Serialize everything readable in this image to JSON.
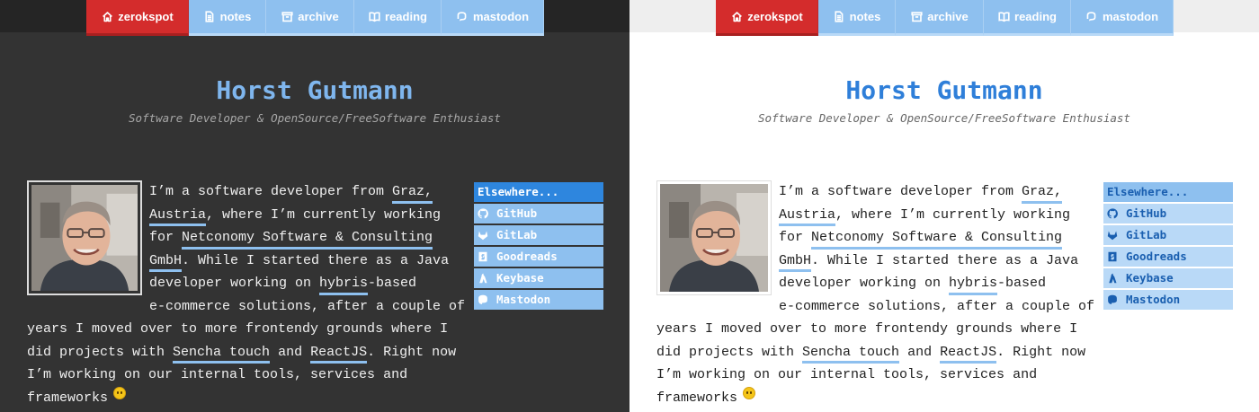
{
  "nav": {
    "items": [
      {
        "label": "zerokspot",
        "icon": "home-icon",
        "active": true
      },
      {
        "label": "notes",
        "icon": "document-icon"
      },
      {
        "label": "archive",
        "icon": "archive-box-icon"
      },
      {
        "label": "reading",
        "icon": "open-book-icon"
      },
      {
        "label": "mastodon",
        "icon": "mastodon-icon"
      }
    ]
  },
  "header": {
    "title": "Horst Gutmann",
    "subtitle": "Software Developer & OpenSource/FreeSoftware Enthusiast"
  },
  "bio": {
    "l1": "I’m a software developer from ",
    "link_graz": "Graz,",
    "link_austria": "Austria",
    "l2": ", where I’m currently working",
    "l3": "for ",
    "link_netconomy_1": "Netconomy Software & Consulting",
    "link_netconomy_2": "GmbH",
    "l4": ". While I started there as a Java",
    "l5": "developer working on ",
    "link_hybris": "hybris",
    "l5b": "-based",
    "l6": "e-commerce solutions, after a couple of",
    "l7": "years I moved over to more frontendy grounds where I",
    "l8": "did projects with ",
    "link_sencha": "Sencha touch",
    "l8b": " and ",
    "link_react": "ReactJS",
    "l8c": ". Right now",
    "l9": "I’m working on our internal tools, services and",
    "l10": "frameworks",
    "emoji": "grinning-face-emoji"
  },
  "elsewhere": {
    "title": "Elsewhere...",
    "items": [
      {
        "label": "GitHub",
        "icon": "github-icon"
      },
      {
        "label": "GitLab",
        "icon": "gitlab-icon"
      },
      {
        "label": "Goodreads",
        "icon": "goodreads-icon"
      },
      {
        "label": "Keybase",
        "icon": "keybase-icon"
      },
      {
        "label": "Mastodon",
        "icon": "mastodon-icon"
      }
    ]
  },
  "themes": {
    "dark": {
      "background": "#333333",
      "title_color": "#7fb6ee",
      "link_underline": "#8ec0ef"
    },
    "light": {
      "background": "#ffffff",
      "title_color": "#2f7fd9",
      "link_underline": "#8ec0ef"
    },
    "nav_active": "#d42c2c",
    "nav_inactive": "#8ec0ef"
  }
}
